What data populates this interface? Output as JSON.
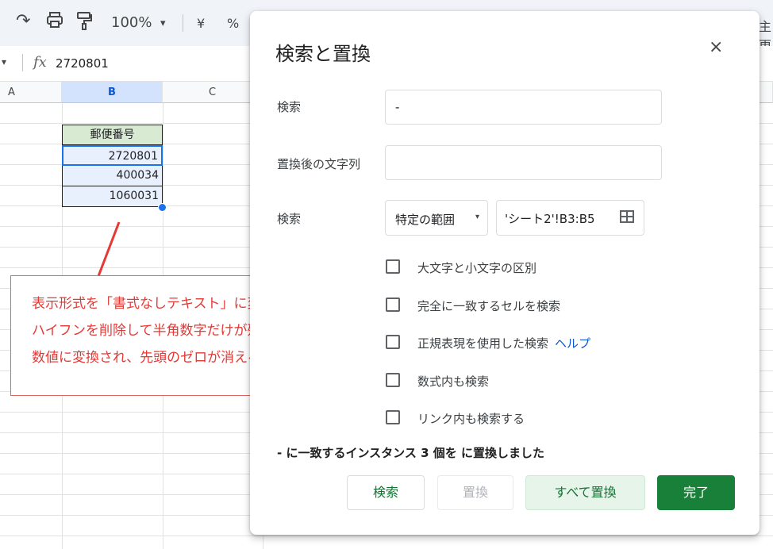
{
  "toolbar": {
    "redo_icon": "↷",
    "print_icon": "⎙",
    "paint_icon": "🖌",
    "zoom": "100%",
    "zoom_caret": "▾",
    "currency": "¥",
    "percent": "%",
    "right_glyph": "主更"
  },
  "formula_bar": {
    "ref_caret": "▾",
    "fx": "fx",
    "value": "2720801"
  },
  "sheet": {
    "columns": [
      "A",
      "B",
      "C"
    ],
    "header_cell": "郵便番号",
    "values": [
      "2720801",
      "400034",
      "1060031"
    ]
  },
  "annotation": {
    "lines": [
      "表示形式を「書式なしテキスト」に変更してないと",
      "ハイフンを削除して半角数字だけが残った場合に",
      "数値に変換され、先頭のゼロが消える"
    ]
  },
  "dialog": {
    "title": "検索と置換",
    "close": "×",
    "find_label": "検索",
    "find_value": "-",
    "replace_label": "置換後の文字列",
    "replace_value": "",
    "scope_label": "検索",
    "scope_select": "特定の範囲",
    "scope_caret": "▾",
    "range_value": "'シート2'!B3:B5",
    "options": [
      {
        "label": "大文字と小文字の区別",
        "checked": false
      },
      {
        "label": "完全に一致するセルを検索",
        "checked": false
      },
      {
        "label": "正規表現を使用した検索",
        "checked": false
      },
      {
        "label": "数式内も検索",
        "checked": false
      },
      {
        "label": "リンク内も検索する",
        "checked": false
      }
    ],
    "help_link": "ヘルプ",
    "status": "- に一致するインスタンス 3 個を に置換しました",
    "buttons": {
      "search": "検索",
      "replace": "置換",
      "replace_all": "すべて置換",
      "done": "完了"
    }
  }
}
